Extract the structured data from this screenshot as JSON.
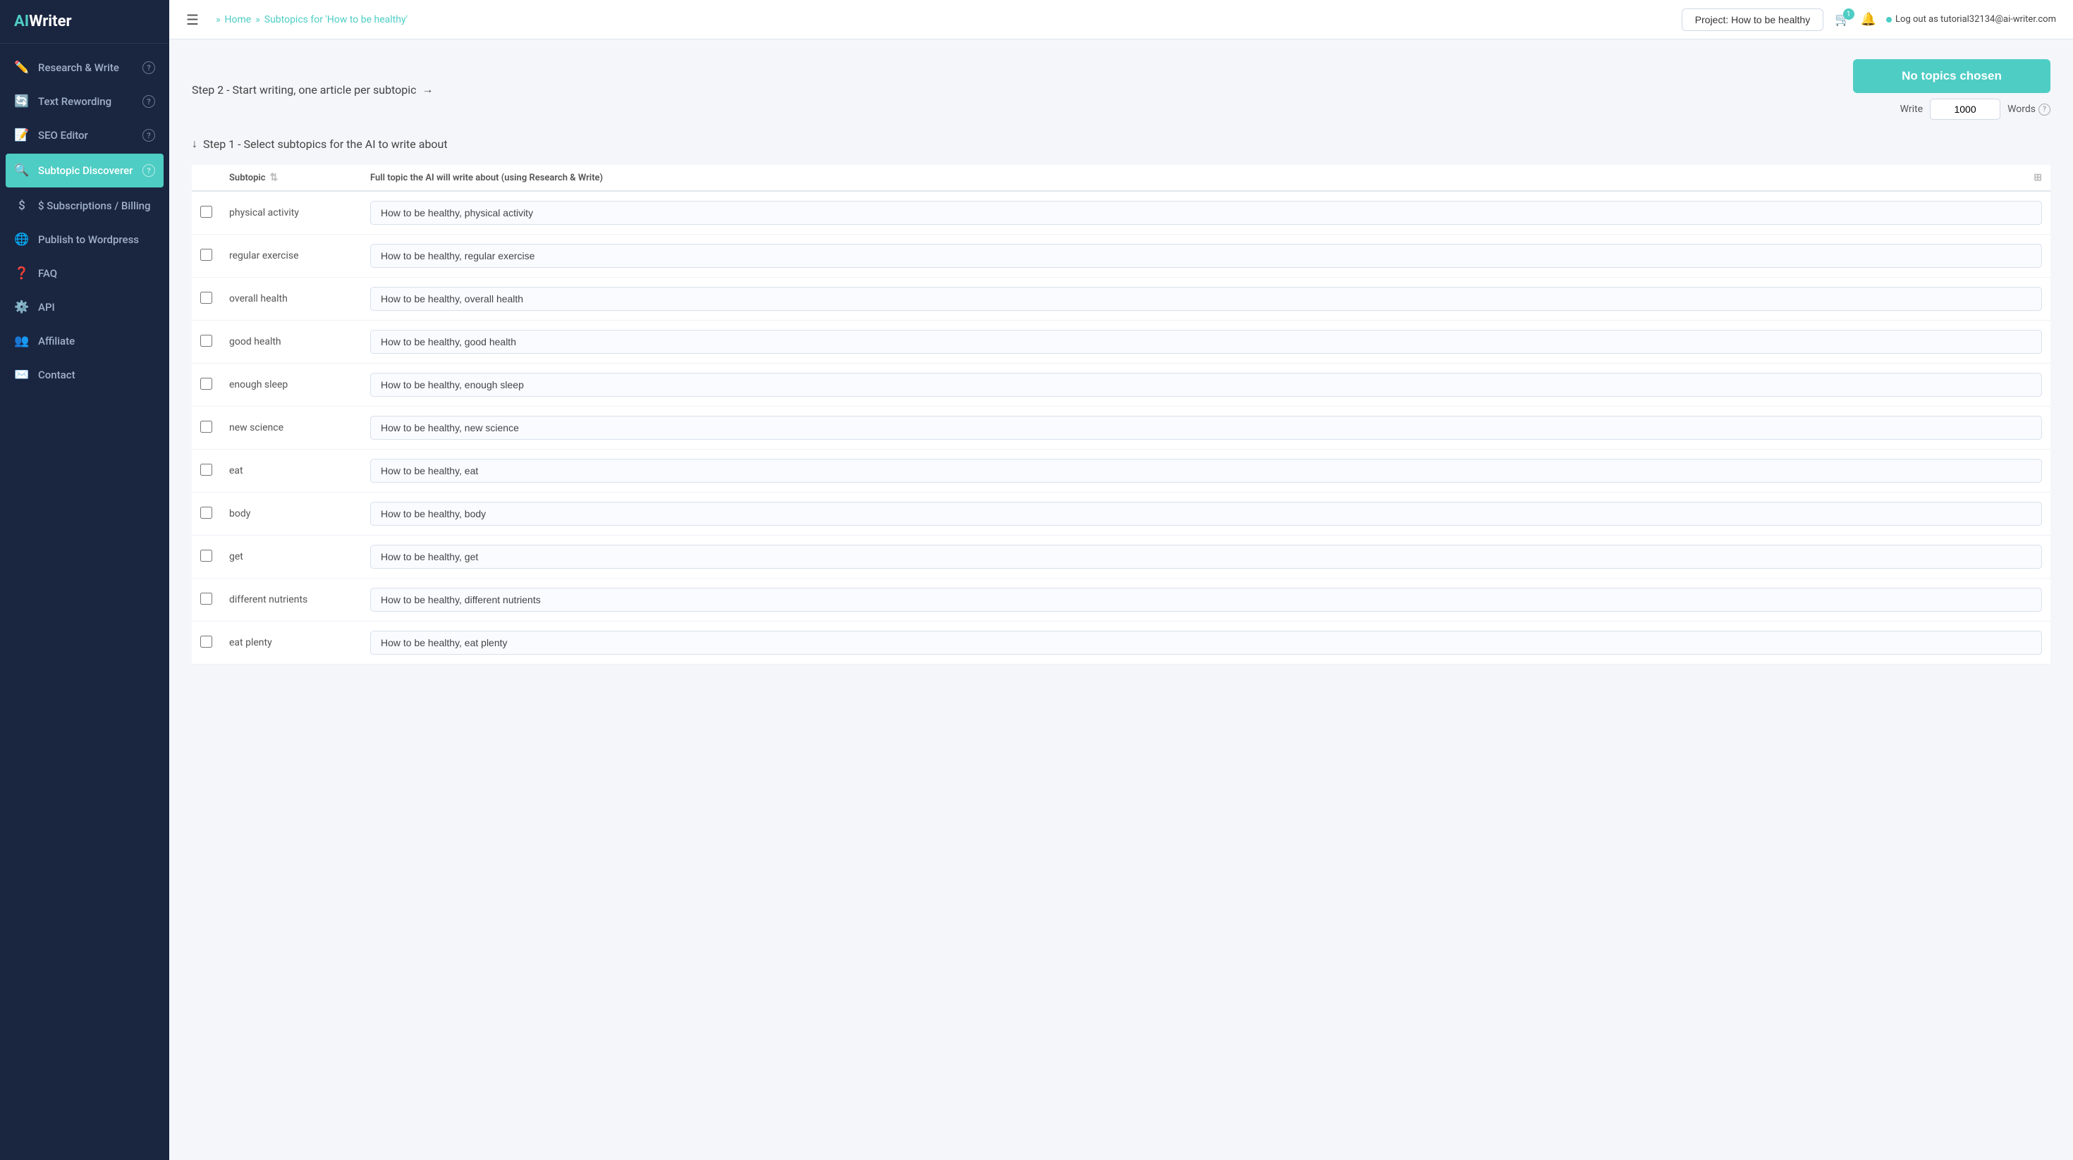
{
  "sidebar": {
    "logo": {
      "ai": "AI",
      "writer": "Writer"
    },
    "items": [
      {
        "id": "research-write",
        "label": "Research & Write",
        "icon": "✏️",
        "has_help": true,
        "active": false
      },
      {
        "id": "text-rewording",
        "label": "Text Rewording",
        "icon": "🔄",
        "has_help": true,
        "active": false
      },
      {
        "id": "seo-editor",
        "label": "SEO Editor",
        "icon": "📝",
        "has_help": true,
        "active": false
      },
      {
        "id": "subtopic-discoverer",
        "label": "Subtopic Discoverer",
        "icon": "🔍",
        "has_help": true,
        "active": true
      },
      {
        "id": "subscriptions-billing",
        "label": "$ Subscriptions / Billing",
        "icon": "$",
        "has_help": false,
        "active": false
      },
      {
        "id": "publish-to-wordpress",
        "label": "Publish to Wordpress",
        "icon": "🌐",
        "has_help": false,
        "active": false
      },
      {
        "id": "faq",
        "label": "FAQ",
        "icon": "❓",
        "has_help": false,
        "active": false
      },
      {
        "id": "api",
        "label": "API",
        "icon": "⚙️",
        "has_help": false,
        "active": false
      },
      {
        "id": "affiliate",
        "label": "Affiliate",
        "icon": "👥",
        "has_help": false,
        "active": false
      },
      {
        "id": "contact",
        "label": "Contact",
        "icon": "✉️",
        "has_help": false,
        "active": false
      }
    ]
  },
  "header": {
    "home_label": "Home",
    "breadcrumb_sep": "»",
    "page_title": "Subtopics for 'How to be healthy'",
    "project_label": "Project: How to be healthy",
    "notification_count": "1",
    "user_label": "Log out as tutorial32134@ai-writer.com"
  },
  "step2": {
    "text": "Step 2 - Start writing, one article per subtopic",
    "arrow": "→",
    "button_label": "No topics chosen",
    "write_label": "Write",
    "write_value": "1000",
    "words_label": "Words"
  },
  "step1": {
    "text": "Step 1 - Select subtopics for the AI to write about",
    "arrow": "↓"
  },
  "table": {
    "col_subtopic": "Subtopic",
    "col_full_topic": "Full topic the AI will write about (using Research & Write)",
    "rows": [
      {
        "subtopic": "physical activity",
        "full_topic": "How to be healthy, physical activity",
        "checked": false
      },
      {
        "subtopic": "regular exercise",
        "full_topic": "How to be healthy, regular exercise",
        "checked": false
      },
      {
        "subtopic": "overall health",
        "full_topic": "How to be healthy, overall health",
        "checked": false
      },
      {
        "subtopic": "good health",
        "full_topic": "How to be healthy, good health",
        "checked": false
      },
      {
        "subtopic": "enough sleep",
        "full_topic": "How to be healthy, enough sleep",
        "checked": false
      },
      {
        "subtopic": "new science",
        "full_topic": "How to be healthy, new science",
        "checked": false
      },
      {
        "subtopic": "eat",
        "full_topic": "How to be healthy, eat",
        "checked": false
      },
      {
        "subtopic": "body",
        "full_topic": "How to be healthy, body",
        "checked": false
      },
      {
        "subtopic": "get",
        "full_topic": "How to be healthy, get",
        "checked": false
      },
      {
        "subtopic": "different nutrients",
        "full_topic": "How to be healthy, different nutrients",
        "checked": false
      },
      {
        "subtopic": "eat plenty",
        "full_topic": "How to be healthy, eat plenty",
        "checked": false
      }
    ]
  }
}
